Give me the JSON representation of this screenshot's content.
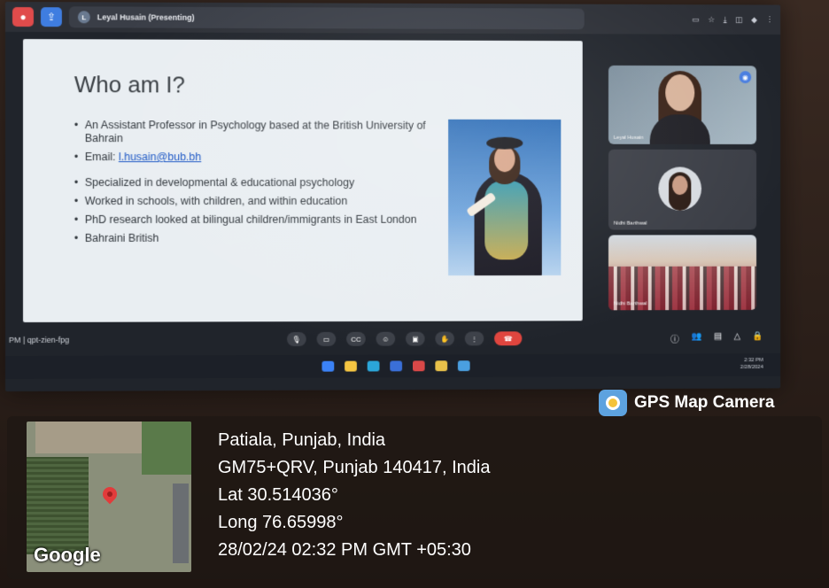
{
  "meet_window": {
    "tab_initial": "L",
    "presenter_label": "Leyal Husain (Presenting)",
    "meeting_code": "PM | qpt-zien-fpg"
  },
  "slide": {
    "title": "Who am I?",
    "bullets": [
      "An Assistant Professor in Psychology based at the British University of Bahrain",
      "Specialized in developmental & educational psychology",
      "Worked in schools, with children, and within education",
      "PhD research looked at bilingual children/immigrants in East London",
      "Bahraini British"
    ],
    "email_label": "Email: ",
    "email_value": "l.husain@bub.bh"
  },
  "participants": [
    {
      "name": "Leyal Husain"
    },
    {
      "name": "Nidhi Barthwal"
    },
    {
      "name": "Nidhi Barthwal"
    }
  ],
  "taskbar": {
    "time": "2:32 PM",
    "date": "2/28/2024"
  },
  "overlay": {
    "brand": "GPS Map Camera",
    "map_attribution": "Google",
    "location": "Patiala, Punjab, India",
    "plus_code": "GM75+QRV, Punjab 140417, India",
    "lat": "Lat 30.514036°",
    "long": "Long 76.65998°",
    "timestamp": "28/02/24 02:32 PM GMT +05:30"
  },
  "icons": [
    "record-icon",
    "share-icon",
    "mic-icon",
    "camera-icon",
    "captions-icon",
    "emoji-icon",
    "present-icon",
    "hand-icon",
    "more-icon",
    "end-call-icon",
    "info-icon",
    "people-icon",
    "chat-icon",
    "activities-icon",
    "lock-icon",
    "map-pin-icon"
  ]
}
